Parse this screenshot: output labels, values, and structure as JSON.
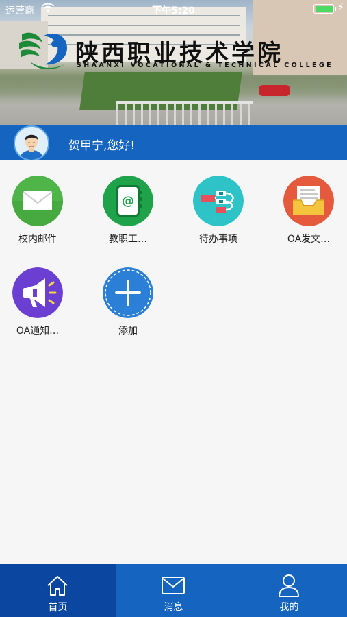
{
  "status_bar": {
    "carrier": "运营商",
    "time": "下午5:20",
    "bolt": "⚡"
  },
  "header": {
    "college_name": "陕西职业技术学院",
    "college_name_en": "SHAANXI VOCATIONAL & TECHNICAL COLLEGE"
  },
  "greeting": {
    "text": "贺甲宁,您好!"
  },
  "apps": [
    {
      "label": "校内邮件",
      "icon": "mail-icon",
      "color": "#4caf50"
    },
    {
      "label": "教职工…",
      "icon": "address-book-icon",
      "color": "#1fa34a"
    },
    {
      "label": "待办事项",
      "icon": "flow-icon",
      "color": "#2ec4c7"
    },
    {
      "label": "OA发文…",
      "icon": "document-tray-icon",
      "color": "#e55a3c"
    },
    {
      "label": "OA通知…",
      "icon": "megaphone-icon",
      "color": "#6a3fd1"
    },
    {
      "label": "添加",
      "icon": "plus-icon",
      "color": "#2c7fd6"
    }
  ],
  "tabbar": {
    "items": [
      {
        "label": "首页",
        "icon": "home-icon",
        "active": true
      },
      {
        "label": "消息",
        "icon": "envelope-icon",
        "active": false
      },
      {
        "label": "我的",
        "icon": "person-icon",
        "active": false
      }
    ]
  },
  "colors": {
    "primary": "#1565c0",
    "primary_dark": "#0b47a1"
  }
}
